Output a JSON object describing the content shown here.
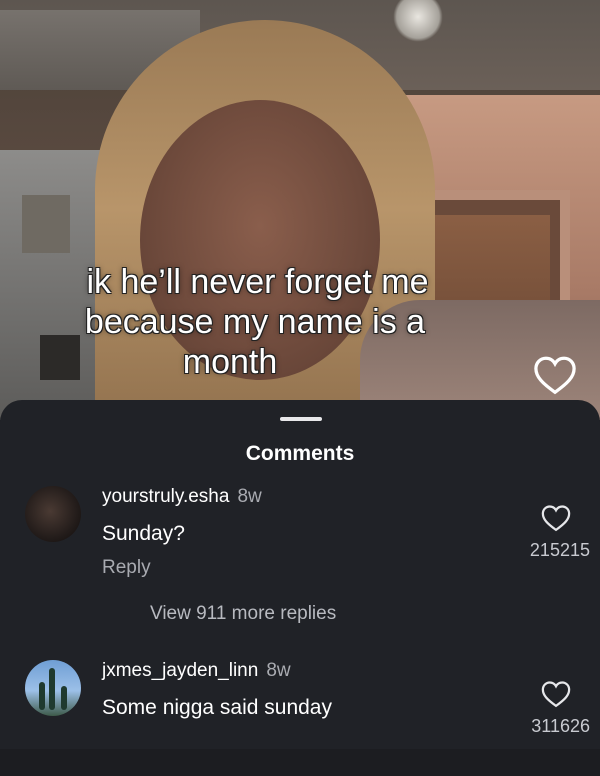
{
  "video": {
    "caption_lines": [
      "ik he’ll never forget me",
      "because my name is a",
      "month"
    ],
    "like_icon": "heart-outline-icon"
  },
  "comments_sheet": {
    "title": "Comments",
    "comments": [
      {
        "username": "yourstruly.esha",
        "age": "8w",
        "text": "Sunday?",
        "reply_label": "Reply",
        "like_count": "215215",
        "view_more": "View 911 more replies"
      },
      {
        "username": "jxmes_jayden_linn",
        "age": "8w",
        "text": "Some nigga said sunday",
        "like_count": "311626"
      }
    ]
  },
  "colors": {
    "sheet_background": "#202227",
    "primary_text": "#ffffff",
    "secondary_text": "#a9abb1"
  }
}
